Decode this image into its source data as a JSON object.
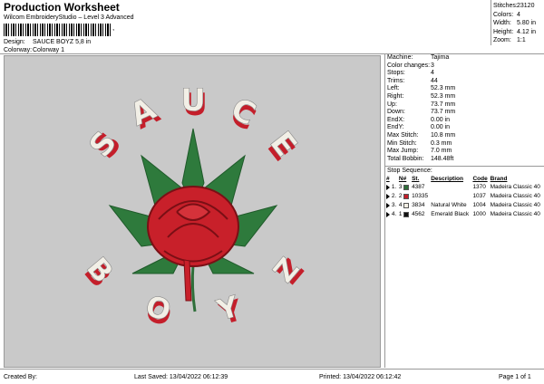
{
  "header": {
    "title": "Production Worksheet",
    "subtitle": "Wilcom EmbroideryStudio – Level 3 Advanced",
    "barcode_mark": ",",
    "design_label": "Design:",
    "design_value": "SAUCE BOYZ 5,8 in",
    "colorway_label": "Colorway:",
    "colorway_value": "Colorway 1"
  },
  "stats": [
    {
      "label": "Stitches:",
      "value": "23120"
    },
    {
      "label": "Colors:",
      "value": "4"
    },
    {
      "label": "Width:",
      "value": "5.80 in"
    },
    {
      "label": "Height:",
      "value": "4.12 in"
    },
    {
      "label": "Zoom:",
      "value": "1:1"
    }
  ],
  "design_preview": {
    "top_text": "SAUCE",
    "bottom_text": "BOYZ",
    "colors": {
      "background": "#c9c9c9",
      "rose": "#c8202a",
      "leaf": "#2e7a3c",
      "letters": "#f2efe6",
      "letter_shadow": "#c41e2a",
      "stem": "#2f6f3a"
    }
  },
  "machine_info": [
    {
      "label": "Machine:",
      "value": "Tajima"
    },
    {
      "label": "Color changes:",
      "value": "3"
    },
    {
      "label": "Stops:",
      "value": "4"
    },
    {
      "label": "Trims:",
      "value": "44"
    },
    {
      "label": "Left:",
      "value": "52.3 mm"
    },
    {
      "label": "Right:",
      "value": "52.3 mm"
    },
    {
      "label": "Up:",
      "value": "73.7 mm"
    },
    {
      "label": "Down:",
      "value": "73.7 mm"
    },
    {
      "label": "EndX:",
      "value": "0.00 in"
    },
    {
      "label": "EndY:",
      "value": "0.00 in"
    },
    {
      "label": "Max Stitch:",
      "value": "10.8 mm"
    },
    {
      "label": "Min Stitch:",
      "value": "0.3 mm"
    },
    {
      "label": "Max Jump:",
      "value": "7.0 mm"
    },
    {
      "label": "Total Bobbin:",
      "value": "148.48ft"
    }
  ],
  "stop_sequence": {
    "title": "Stop Sequence:",
    "headers": [
      "#",
      "N#",
      "St.",
      "Description",
      "Code",
      "Brand"
    ],
    "rows": [
      {
        "num": "1.",
        "n": "3",
        "color": "#2f6f3a",
        "st": "4387",
        "desc": "",
        "code": "1370",
        "brand": "Madeira Classic 40"
      },
      {
        "num": "2.",
        "n": "2",
        "color": "#c41e2a",
        "st": "10335",
        "desc": "",
        "code": "1037",
        "brand": "Madeira Classic 40"
      },
      {
        "num": "3.",
        "n": "4",
        "color": "#f3efe4",
        "st": "3834",
        "desc": "Natural White",
        "code": "1004",
        "brand": "Madeira Classic 40"
      },
      {
        "num": "4.",
        "n": "1",
        "color": "#111111",
        "st": "4562",
        "desc": "Emerald Black",
        "code": "1000",
        "brand": "Madeira Classic 40"
      }
    ]
  },
  "footer": {
    "created_by": "Created By:",
    "last_saved": "Last Saved: 13/04/2022 06:12:39",
    "printed": "Printed: 13/04/2022 06:12:42",
    "page": "Page 1 of 1"
  }
}
